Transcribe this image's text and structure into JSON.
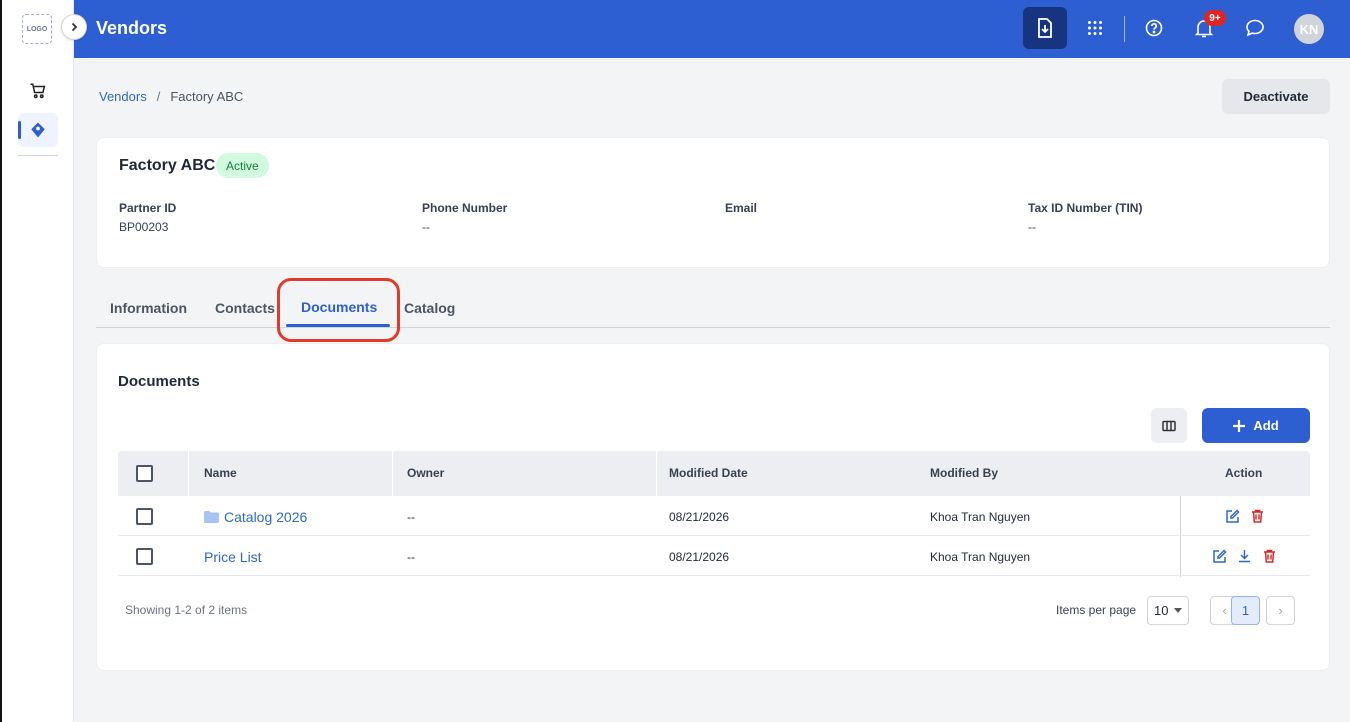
{
  "app": {
    "title": "Vendors",
    "logo_text": "LOGO",
    "notification_count": "9+",
    "user_initials": "KN"
  },
  "colors": {
    "primary": "#2d5fd3",
    "export_button": "#16347f",
    "active_badge_bg": "#d1fadf",
    "active_badge_text": "#15803d",
    "delete_icon": "#dc2626",
    "highlight": "#e23b2a"
  },
  "icons": {
    "sidebar": [
      "cart-icon",
      "vendor-tag-icon"
    ],
    "topbar": [
      "export-download-icon",
      "apps-grid-icon",
      "help-icon",
      "bell-icon",
      "chat-icon"
    ]
  },
  "breadcrumb": {
    "parent": "Vendors",
    "separator": "/",
    "current": "Factory ABC"
  },
  "actions": {
    "deactivate_label": "Deactivate"
  },
  "vendor": {
    "name": "Factory ABC",
    "status": "Active",
    "fields": [
      {
        "label": "Partner ID",
        "value": "BP00203"
      },
      {
        "label": "Phone Number",
        "value": "--"
      },
      {
        "label": "Email",
        "value": ""
      },
      {
        "label": "Tax ID Number (TIN)",
        "value": "--"
      }
    ]
  },
  "tabs": [
    {
      "label": "Information",
      "active": false
    },
    {
      "label": "Contacts",
      "active": false
    },
    {
      "label": "Documents",
      "active": true
    },
    {
      "label": "Catalog",
      "active": false
    }
  ],
  "documents": {
    "title": "Documents",
    "add_label": "Add",
    "columns": [
      "Name",
      "Owner",
      "Modified Date",
      "Modified By",
      "Action"
    ],
    "rows": [
      {
        "name": "Catalog 2026",
        "type": "folder",
        "owner": "--",
        "modified_date": "08/21/2026",
        "modified_by": "Khoa Tran Nguyen",
        "actions": [
          "edit-icon",
          "delete-icon"
        ]
      },
      {
        "name": "Price List",
        "type": "file",
        "owner": "--",
        "modified_date": "08/21/2026",
        "modified_by": "Khoa Tran Nguyen",
        "actions": [
          "edit-icon",
          "download-icon",
          "delete-icon"
        ]
      }
    ],
    "showing_text": "Showing 1-2 of 2 items",
    "items_per_page_label": "Items per page",
    "items_per_page": "10",
    "current_page": "1",
    "prev_symbol": "‹",
    "next_symbol": "›"
  }
}
